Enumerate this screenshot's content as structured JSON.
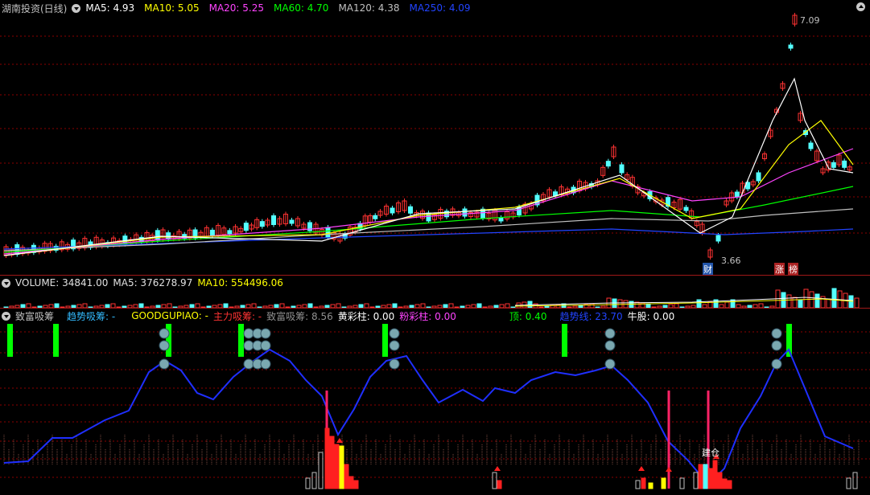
{
  "price_header": {
    "title": "湖南投资(日线)",
    "ma": [
      {
        "label": "MA5:",
        "value": "4.93",
        "color": "#ffffff"
      },
      {
        "label": "MA10:",
        "value": "5.05",
        "color": "#ffff00"
      },
      {
        "label": "MA20:",
        "value": "5.25",
        "color": "#ff44ff"
      },
      {
        "label": "MA60:",
        "value": "4.70",
        "color": "#00ff00"
      },
      {
        "label": "MA120:",
        "value": "4.38",
        "color": "#c0c0c0"
      },
      {
        "label": "MA250:",
        "value": "4.09",
        "color": "#2244ff"
      }
    ]
  },
  "price_annotations": {
    "high_label": "7.09",
    "low_label": "3.66",
    "tag_cai": "财",
    "tag_zhang": "涨",
    "tag_bang": "榜"
  },
  "volume_header": {
    "title": "VOLUME: 34841.00",
    "ma5": "MA5: 376278.97",
    "ma10": "MA10: 554496.06"
  },
  "indicator_header": {
    "title": "致富吸筹",
    "items": [
      {
        "label": "趋势吸筹: -",
        "color": "#33bbff"
      },
      {
        "label": "GOODGUPIAO: -",
        "color": "#ffff00"
      },
      {
        "label": "主力吸筹: -",
        "color": "#ff3333"
      },
      {
        "label": "致富吸筹: 8.56",
        "color": "#909090"
      },
      {
        "label": "黄彩柱: 0.00",
        "color": "#ffffff"
      },
      {
        "label": "粉彩柱: 0.00",
        "color": "#ff44ff"
      },
      {
        "label": "顶: 0.40",
        "color": "#00ff00"
      },
      {
        "label": "趋势线: 23.70",
        "color": "#2244ff"
      },
      {
        "label": "牛股: 0.00",
        "color": "#ffffff"
      }
    ]
  },
  "indicator_annotations": {
    "jiancang": "建仓"
  },
  "colors": {
    "up": "#ff3232",
    "down": "#54ffff",
    "grid": "#8b0000",
    "trend": "#1f2fff",
    "signal_green": "#00ff00"
  }
}
